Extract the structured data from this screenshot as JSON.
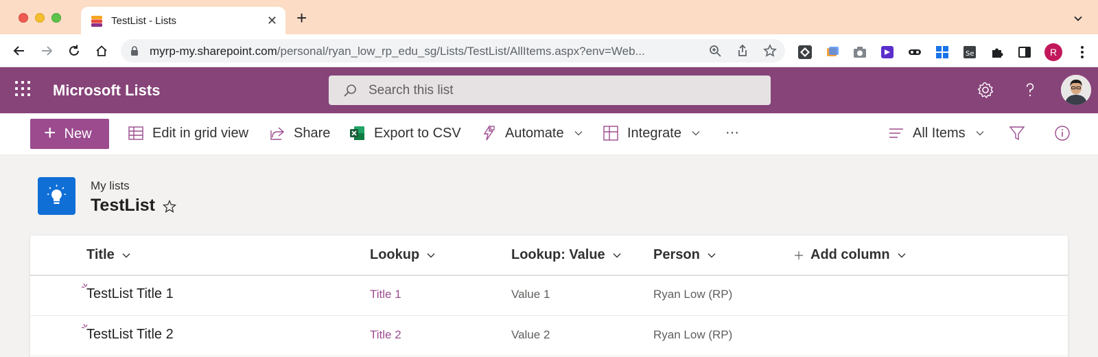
{
  "browser": {
    "tab_title": "TestList - Lists",
    "url_host": "myrp-my.sharepoint.com",
    "url_path": "/personal/ryan_low_rp_edu_sg/Lists/TestList/AllItems.aspx?env=Web...",
    "profile_initial": "R"
  },
  "suite": {
    "app_name": "Microsoft Lists",
    "search_placeholder": "Search this list"
  },
  "commands": {
    "new": "New",
    "edit_grid": "Edit in grid view",
    "share": "Share",
    "export": "Export to CSV",
    "automate": "Automate",
    "integrate": "Integrate",
    "more": "···",
    "view": "All Items"
  },
  "header": {
    "breadcrumb": "My lists",
    "title": "TestList"
  },
  "table": {
    "columns": [
      {
        "label": "Title"
      },
      {
        "label": "Lookup"
      },
      {
        "label": "Lookup: Value"
      },
      {
        "label": "Person"
      },
      {
        "label": "Add column"
      }
    ],
    "rows": [
      {
        "title": "TestList Title 1",
        "lookup": "Title 1",
        "value": "Value 1",
        "person": "Ryan Low (RP)"
      },
      {
        "title": "TestList Title 2",
        "lookup": "Title 2",
        "value": "Value 2",
        "person": "Ryan Low (RP)"
      }
    ]
  },
  "colors": {
    "suite_bar": "#874479",
    "accent": "#9b4b8e",
    "list_icon": "#0f6fd6",
    "tab_strip": "#fcdcc5"
  }
}
